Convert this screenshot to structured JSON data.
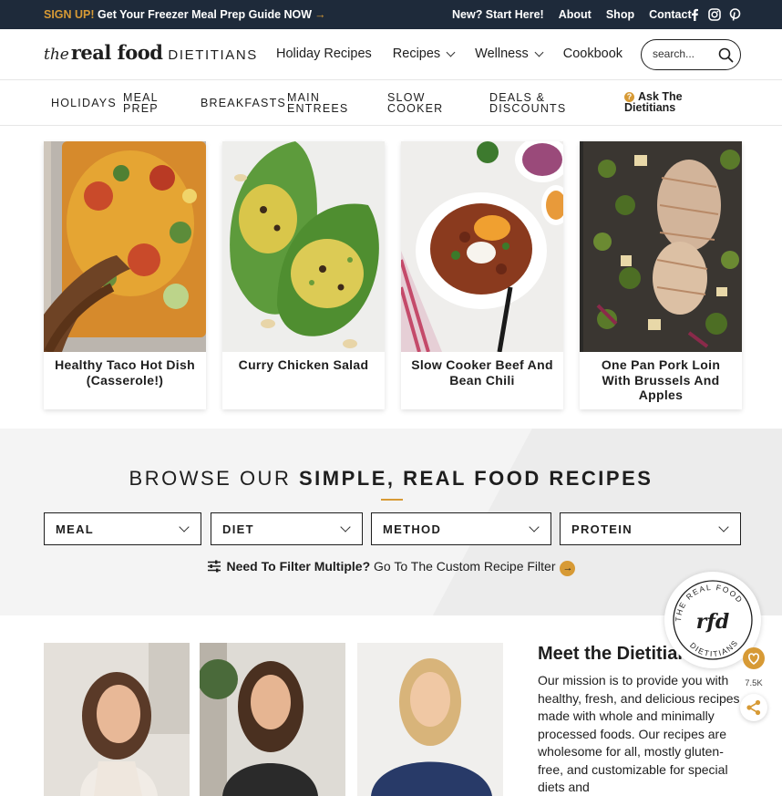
{
  "topbar": {
    "signup": "SIGN UP!",
    "promo": "Get Your Freezer Meal Prep Guide NOW",
    "links": [
      "New? Start Here!",
      "About",
      "Shop",
      "Contact"
    ],
    "social": [
      "facebook-icon",
      "instagram-icon",
      "pinterest-icon"
    ]
  },
  "header": {
    "logo_the": "the",
    "logo_realfood": "real food",
    "logo_dietitians": "DIETITIANS",
    "nav": [
      "Holiday Recipes",
      "Recipes",
      "Wellness",
      "Cookbook"
    ],
    "search_placeholder": "search..."
  },
  "subnav": {
    "holidays": "Holidays",
    "mealprep": [
      "Meal",
      "Prep"
    ],
    "breakfasts": "Breakfasts",
    "main": [
      "Main",
      "Entrees"
    ],
    "slow": [
      "Slow",
      "Cooker"
    ],
    "deals": [
      "Deals &",
      "Discounts"
    ],
    "ask": [
      "Ask The",
      "Dietitians"
    ]
  },
  "cards": [
    {
      "title": "Healthy Taco Hot Dish (Casserole!)"
    },
    {
      "title": "Curry Chicken Salad"
    },
    {
      "title": "Slow Cooker Beef And Bean Chili"
    },
    {
      "title": "One Pan Pork Loin With Brussels And Apples"
    }
  ],
  "browse": {
    "heading_light": "BROWSE OUR",
    "heading_bold": "SIMPLE, REAL FOOD RECIPES",
    "filters": [
      "Meal",
      "Diet",
      "Method",
      "Protein"
    ],
    "filter_bold": "Need To Filter Multiple?",
    "filter_link": "Go To The Custom Recipe Filter"
  },
  "meet": {
    "title": "Meet the Dietitians",
    "body": "Our mission is to provide you with healthy, fresh, and delicious recipes made with whole and minimally processed foods. Our recipes are wholesome for all, mostly gluten-free, and customizable for special diets and"
  },
  "badge": {
    "top": "THE REAL FOOD",
    "mono": "rfd",
    "bottom": "DIETITIANS"
  },
  "favorites": {
    "count": "7.5K"
  },
  "colors": {
    "navy": "#1e2a3a",
    "gold": "#d79a35"
  }
}
